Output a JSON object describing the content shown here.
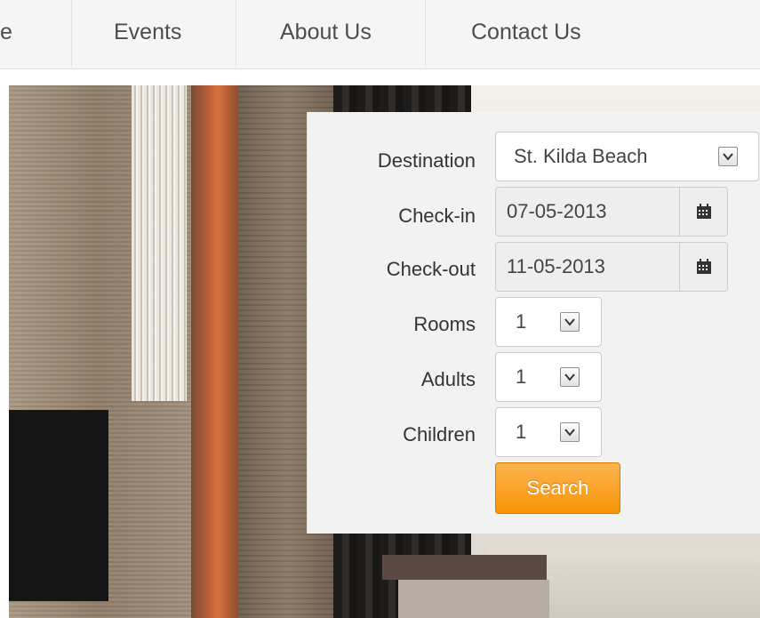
{
  "nav": {
    "items": [
      {
        "label": "e"
      },
      {
        "label": "Events"
      },
      {
        "label": "About Us"
      },
      {
        "label": "Contact Us"
      }
    ]
  },
  "booking": {
    "destination": {
      "label": "Destination",
      "value": "St. Kilda Beach"
    },
    "checkin": {
      "label": "Check-in",
      "value": "07-05-2013",
      "icon": "calendar-icon"
    },
    "checkout": {
      "label": "Check-out",
      "value": "11-05-2013",
      "icon": "calendar-icon"
    },
    "rooms": {
      "label": "Rooms",
      "value": "1"
    },
    "adults": {
      "label": "Adults",
      "value": "1"
    },
    "children": {
      "label": "Children",
      "value": "1"
    },
    "search_label": "Search"
  },
  "colors": {
    "nav_bg": "#f5f5f5",
    "panel_bg": "#f2f2f2",
    "button_orange": "#f89406"
  }
}
